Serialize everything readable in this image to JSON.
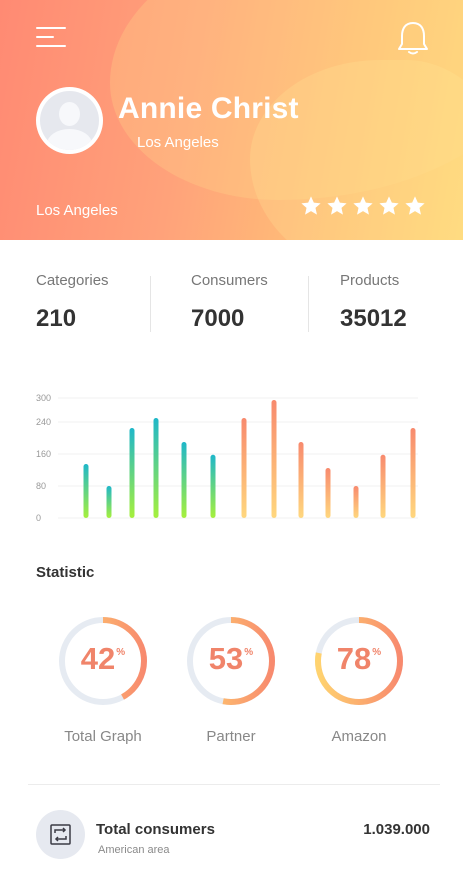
{
  "header": {
    "name": "Annie Christ",
    "sublocation": "Los Angeles",
    "location": "Los Angeles",
    "rating": 5,
    "rating_max": 5,
    "icons": [
      "menu-icon",
      "bell-icon",
      "star-icon"
    ]
  },
  "stats": [
    {
      "label": "Categories",
      "value": "210"
    },
    {
      "label": "Consumers",
      "value": "7000"
    },
    {
      "label": "Products",
      "value": "35012"
    }
  ],
  "chart_data": {
    "type": "bar",
    "ylim": [
      0,
      300
    ],
    "yticks": [
      "300",
      "240",
      "160",
      "80",
      "0"
    ],
    "ytick_values": [
      300,
      240,
      160,
      80,
      0
    ],
    "grid": true,
    "values": [
      135,
      80,
      225,
      250,
      190,
      158,
      250,
      295,
      190,
      125,
      80,
      158,
      225
    ],
    "colors": {
      "group1_top": "#1fb7c9",
      "group1_bottom": "#a6f03c",
      "group2_top": "#f88a6e",
      "group2_bottom": "#ffd77e"
    }
  },
  "statistic": {
    "title": "Statistic",
    "items": [
      {
        "label": "Total Graph",
        "value": 42
      },
      {
        "label": "Partner",
        "value": 53
      },
      {
        "label": "Amazon",
        "value": 78
      }
    ],
    "percent_sign": "%",
    "colors": {
      "start": "#ffd36f",
      "end": "#f88a6e",
      "track": "#e6ebf2"
    }
  },
  "consumers": {
    "title": "Total consumers",
    "subtitle": "American area",
    "value": "1.039.000",
    "icon": "refresh-icon"
  }
}
